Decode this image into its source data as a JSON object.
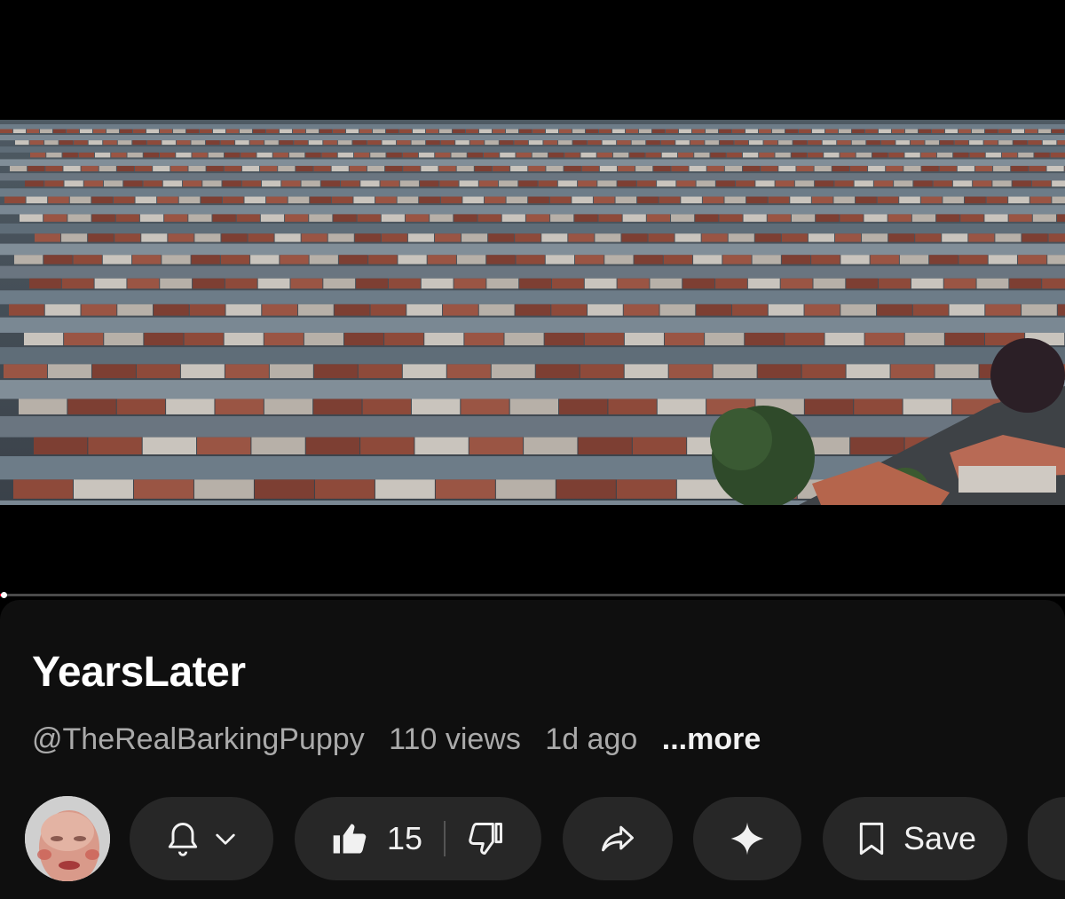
{
  "video": {
    "thumbnail_description_icon": "aerial-terraced-houses",
    "progress_fraction": 0.003,
    "progress_color": "#ff0033"
  },
  "title": "YearsLater",
  "channel": {
    "handle": "@TheRealBarkingPuppy",
    "views": "110 views",
    "age": "1d ago",
    "more_label": "...more"
  },
  "actions": {
    "subscribe_icon": "bell-icon",
    "dropdown_icon": "chevron-down-icon",
    "like_icon": "thumbs-up-icon",
    "like_count": "15",
    "dislike_icon": "thumbs-down-icon",
    "share_icon": "share-icon",
    "ask_icon": "sparkle-icon",
    "save_icon": "bookmark-icon",
    "save_label": "Save"
  },
  "colors": {
    "background": "#000000",
    "panel": "#0f0f0f",
    "pill": "#272727",
    "text": "#f1f1f1",
    "secondary_text": "#aaaaaa"
  }
}
